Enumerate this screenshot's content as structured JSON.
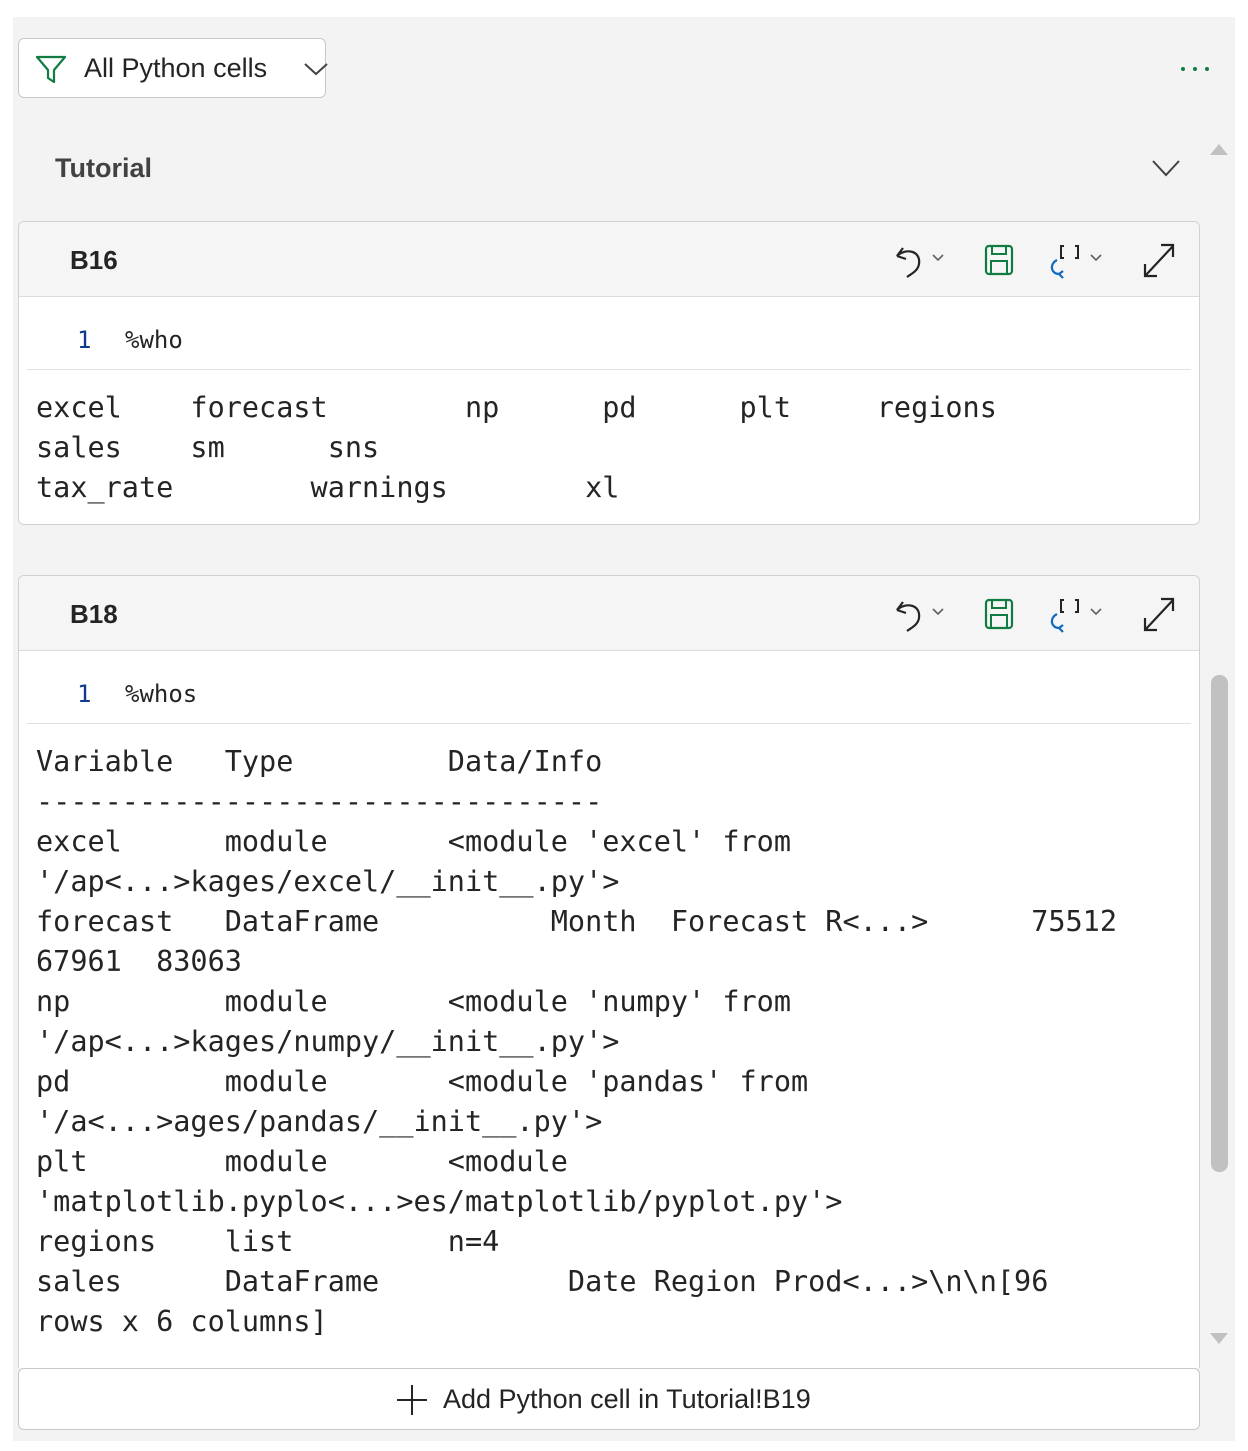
{
  "filter": {
    "label": "All Python cells"
  },
  "section": {
    "title": "Tutorial"
  },
  "cells": [
    {
      "ref": "B16",
      "line_number": "1",
      "code": "%who",
      "output": "excel    forecast        np      pd      plt     regions\nsales    sm      sns\ntax_rate        warnings        xl"
    },
    {
      "ref": "B18",
      "line_number": "1",
      "code": "%whos",
      "output": "Variable   Type         Data/Info\n---------------------------------\nexcel      module       <module 'excel' from\n'/ap<...>kages/excel/__init__.py'>\nforecast   DataFrame          Month  Forecast R<...>      75512\n67961  83063\nnp         module       <module 'numpy' from\n'/ap<...>kages/numpy/__init__.py'>\npd         module       <module 'pandas' from\n'/a<...>ages/pandas/__init__.py'>\nplt        module       <module\n'matplotlib.pyplo<...>es/matplotlib/pyplot.py'>\nregions    list         n=4\nsales      DataFrame           Date Region Prod<...>\\n\\n[96\nrows x 6 columns]"
    }
  ],
  "add_cell": {
    "label": "Add Python cell in Tutorial!B19"
  },
  "icons": {
    "filter": "filter-icon",
    "more": "more-options-icon",
    "undo": "undo-icon",
    "save": "save-icon",
    "output_type": "output-type-icon",
    "expand": "expand-icon",
    "add": "plus-icon"
  },
  "colors": {
    "filter_icon": "#107c41",
    "save_icon": "#107c41",
    "more_icon": "#107c41",
    "output_icon": "#0f6cbd",
    "line_number": "#0f3a8c"
  }
}
